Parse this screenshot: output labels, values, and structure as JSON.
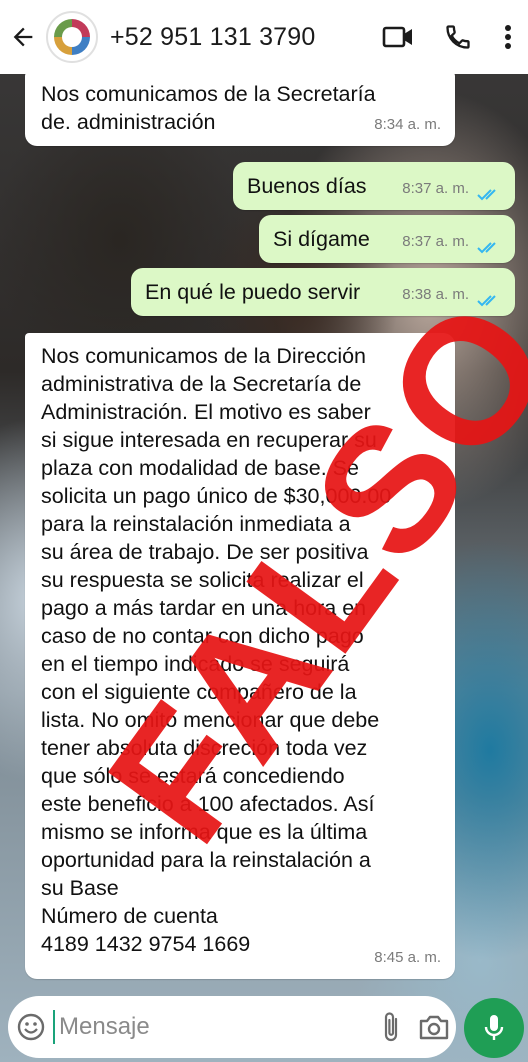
{
  "header": {
    "contact": "+52 951 131 3790"
  },
  "messages": [
    {
      "direction": "in",
      "text": "Nos comunicamos de la Secretaría\nde. administración",
      "time": "8:34 a. m."
    },
    {
      "direction": "out",
      "text": "Buenos días",
      "time": "8:37 a. m.",
      "status": "read"
    },
    {
      "direction": "out",
      "text": "Si dígame",
      "time": "8:37 a. m.",
      "status": "read"
    },
    {
      "direction": "out",
      "text": "En qué le puedo servir",
      "time": "8:38 a. m.",
      "status": "read"
    },
    {
      "direction": "in",
      "text": "Nos comunicamos de la Dirección\nadministrativa de la Secretaría de\nAdministración. El motivo es saber\nsi sigue interesada en recuperar su\nplaza con modalidad de base. Se\nsolicita un pago único de $30,000.00\npara la reinstalación inmediata a\nsu área de trabajo. De ser positiva\nsu respuesta se solicita realizar el\npago a más tardar en una hora en\ncaso de no contar con dicho pago\nen el tiempo indicado se seguirá\ncon el siguiente compañero de la\nlista. No omito mencionar que debe\ntener absoluta discreción toda vez\nque sólo se estará concediendo\neste beneficio a 100 afectados. Así\nmismo se informa que es la última\noportunidad para la reinstalación a\nsu Base\nNúmero de cuenta\n4189 1432 9754 1669",
      "time": "8:45 a. m."
    }
  ],
  "overlay": {
    "stamp_text": "FALSO",
    "color": "#e61414"
  },
  "composer": {
    "placeholder": "Mensaje"
  },
  "colors": {
    "outgoing": "#dcf8c6",
    "incoming": "#ffffff",
    "accent": "#1f9e55",
    "read_ticks": "#34b7f1"
  },
  "icons": [
    "back-arrow-icon",
    "video-call-icon",
    "phone-icon",
    "more-vert-icon",
    "emoji-icon",
    "attach-icon",
    "camera-icon",
    "mic-icon",
    "double-check-icon"
  ]
}
